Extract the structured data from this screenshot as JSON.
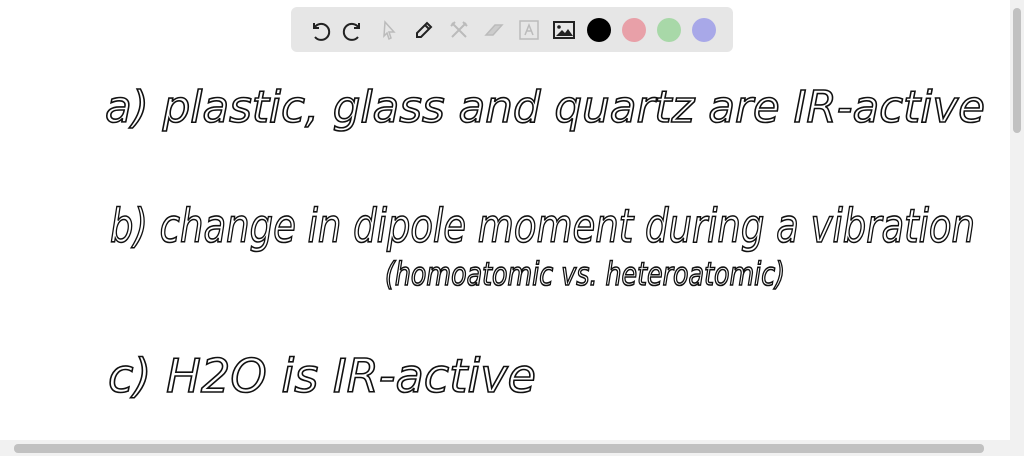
{
  "toolbar": {
    "tools": [
      "undo-icon",
      "redo-icon",
      "select-icon",
      "pen-icon",
      "tools-icon",
      "eraser-icon",
      "text-icon",
      "image-icon"
    ],
    "colors": [
      "#000000",
      "#e8a0a8",
      "#a8d8a8",
      "#a8a8e8"
    ]
  },
  "notes": {
    "line_a": "a) plastic, glass and quartz are IR-active",
    "line_b": "b) change in dipole moment during a vibration",
    "line_b2": "(homoatomic vs. heteroatomic)",
    "line_c": "c) H2O is IR-active"
  }
}
